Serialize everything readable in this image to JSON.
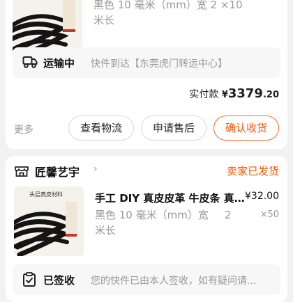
{
  "order1": {
    "spec_line1": "黑色 10 毫米（mm）宽    2    ×10",
    "spec_line2": "米长",
    "logistics": {
      "status": "运输中",
      "detail": "快件到达【东莞虎门转运中心】"
    },
    "paid_label": "实付款",
    "currency": "¥",
    "amount_int": "3379",
    "amount_dec": ".20",
    "more_label": "更多",
    "buttons": {
      "view_logistics": "查看物流",
      "after_sales": "申请售后",
      "confirm_receipt": "确认收货"
    }
  },
  "order2": {
    "shop_name": "匠馨艺宇",
    "shop_chevron": "›",
    "order_status": "卖家已发货",
    "title": "手工 DIY 真皮皮革 牛皮条 真…",
    "price": "¥32.00",
    "spec_line1": "黑色 10 毫米（mm）宽",
    "spec_size": "2",
    "quantity": "×50",
    "spec_line2": "米长",
    "image_caption": "头层真皮材料",
    "logistics": {
      "status": "已签收",
      "detail": "您的快件已由本人签收，如有疑问请..."
    }
  },
  "colors": {
    "accent": "#ff5500",
    "accent_border": "#ff6a1a",
    "background": "#f2f2f2"
  }
}
